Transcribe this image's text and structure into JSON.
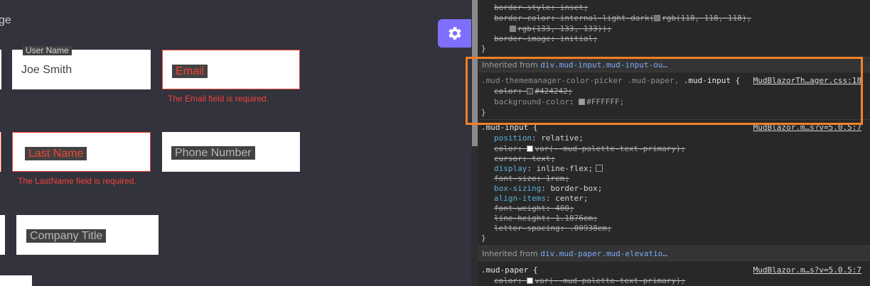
{
  "app": {
    "heading_fragment": "ge",
    "fields": {
      "user_name": {
        "label": "User Name",
        "value": "Joe Smith"
      },
      "email": {
        "label": "Email",
        "helper": "The Email field is required."
      },
      "last_name": {
        "label": "Last Name",
        "helper": "The LastName field is required."
      },
      "phone_number": {
        "label": "Phone Number"
      },
      "company_title": {
        "label": "Company Title"
      }
    },
    "theme_button_icon": "gear-icon",
    "colors": {
      "accent": "#7e6fff",
      "error": "#f44336",
      "background": "#32333d"
    }
  },
  "devtools": {
    "top_rule": {
      "border_style": {
        "name": "border-style",
        "value": "inset;"
      },
      "border_color_name": "border-color",
      "border_color_value_1": "internal-light-dark(",
      "border_color_value_2": "rgb(118, 118, 118),",
      "border_color_value_3": "rgb(133, 133, 133));",
      "border_image": {
        "name": "border-image",
        "value": "initial;"
      },
      "close": "}"
    },
    "inherited_1": {
      "prefix": "Inherited from",
      "node": "div.mud-input.mud-input-ou…"
    },
    "theme_rule": {
      "selector_sub": ".mud-thememanager-color-picker .mud-paper,",
      "selector_main": ".mud-input {",
      "source": "MudBlazorTh…ager.css:18",
      "color": {
        "name": "color",
        "value": "#424242;",
        "swatch": "#424242"
      },
      "background_color": {
        "name": "background-color",
        "value": "#FFFFFF;",
        "swatch": "#9e9e9e"
      },
      "close": "}"
    },
    "mud_input_rule": {
      "selector": ".mud-input {",
      "source": "MudBlazor.m…s?v=5.0.5:7",
      "props": [
        {
          "name": "position",
          "value": "relative;",
          "struck": false
        },
        {
          "name": "color",
          "value": "var(--mud-palette-text-primary);",
          "struck": true,
          "swatch": "#ffffff"
        },
        {
          "name": "cursor",
          "value": "text;",
          "struck": true
        },
        {
          "name": "display",
          "value": "inline-flex;",
          "struck": false
        },
        {
          "name": "font-size",
          "value": "1rem;",
          "struck": true
        },
        {
          "name": "box-sizing",
          "value": "border-box;",
          "struck": false
        },
        {
          "name": "align-items",
          "value": "center;",
          "struck": false
        },
        {
          "name": "font-weight",
          "value": "400;",
          "struck": true
        },
        {
          "name": "line-height",
          "value": "1.1876em;",
          "struck": true
        },
        {
          "name": "letter-spacing",
          "value": ".00938em;",
          "struck": true
        }
      ],
      "close": "}"
    },
    "inherited_2": {
      "prefix": "Inherited from",
      "node": "div.mud-paper.mud-elevatio…"
    },
    "mud_paper_rule": {
      "selector": ".mud-paper {",
      "source": "MudBlazor.m…s?v=5.0.5:7",
      "color": {
        "name": "color",
        "value": "var(--mud-palette-text-primary);",
        "swatch": "#ffffff"
      }
    },
    "highlight_color": "#f48123"
  }
}
